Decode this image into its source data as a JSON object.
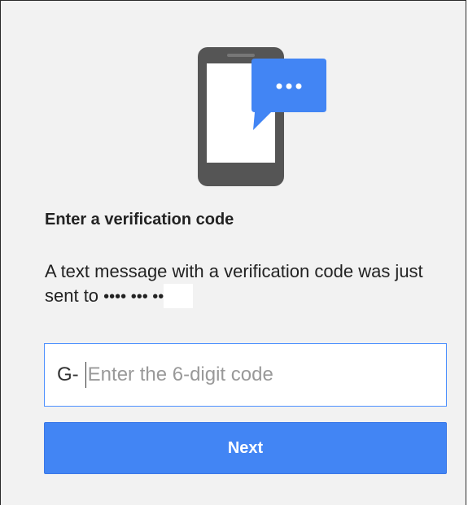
{
  "verification": {
    "title": "Enter a verification code",
    "message_prefix": "A text message with a verification code was just sent to ",
    "masked_number": "•••• ••• ••",
    "code_prefix": "G-",
    "code_placeholder": "Enter the 6-digit code",
    "code_value": ""
  },
  "actions": {
    "next_label": "Next"
  },
  "icons": {
    "illustration": "phone-with-chat-bubble-icon"
  },
  "colors": {
    "accent": "#4285f4",
    "input_border": "#4d90fe",
    "phone_body": "#555555",
    "chat_bubble": "#4285f4",
    "background": "#f2f2f2"
  }
}
